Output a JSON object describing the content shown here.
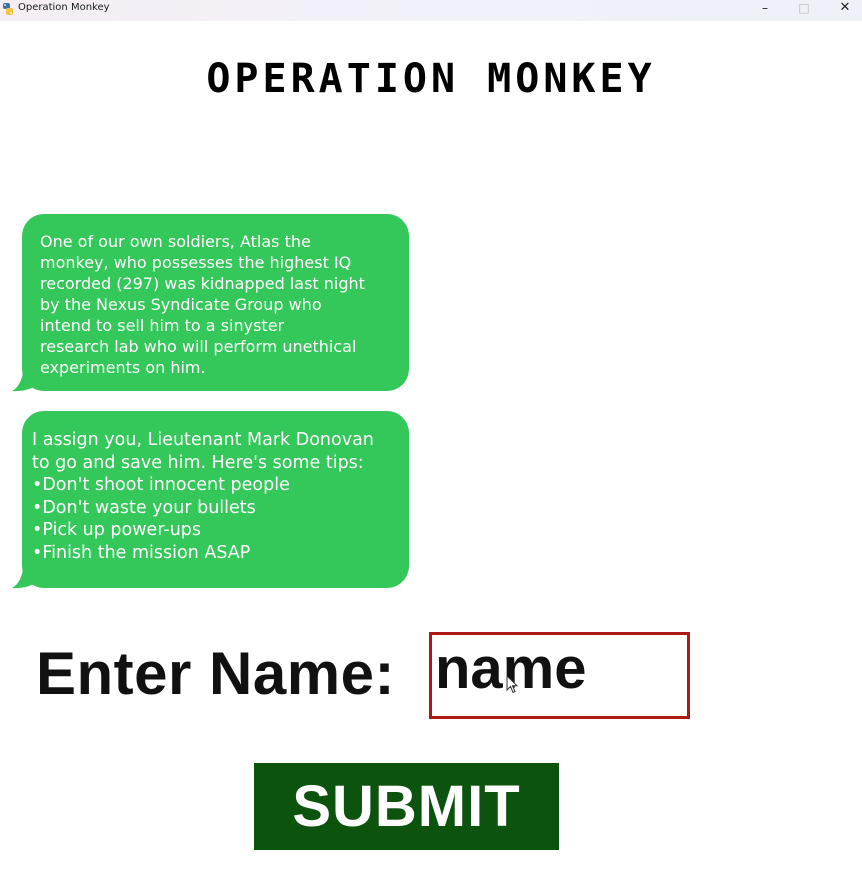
{
  "window": {
    "title": "Operation Monkey",
    "minimize_glyph": "–",
    "maximize_glyph": "□",
    "close_glyph": "✕",
    "app_icon": "python-icon"
  },
  "game": {
    "title": "OPERATION MONKEY"
  },
  "messages": [
    {
      "lines": [
        "One of our own soldiers, Atlas the",
        "monkey, who possesses the highest IQ",
        "recorded (297) was kidnapped last night",
        "by the Nexus Syndicate Group who",
        "intend to sell him to a sinyster",
        "research lab who will perform unethical",
        "experiments on him."
      ]
    },
    {
      "lines": [
        "I assign you, Lieutenant Mark Donovan",
        "to go and save him. Here's some tips:",
        "•Don't shoot innocent people",
        "•Don't waste your bullets",
        "•Pick up power-ups",
        "•Finish the mission ASAP"
      ]
    }
  ],
  "form": {
    "label": "Enter Name:",
    "name_placeholder": "name",
    "submit_label": "SUBMIT"
  },
  "colors": {
    "bubble": "#34c759",
    "submit_bg": "#0c530d",
    "input_border": "#b01818"
  }
}
